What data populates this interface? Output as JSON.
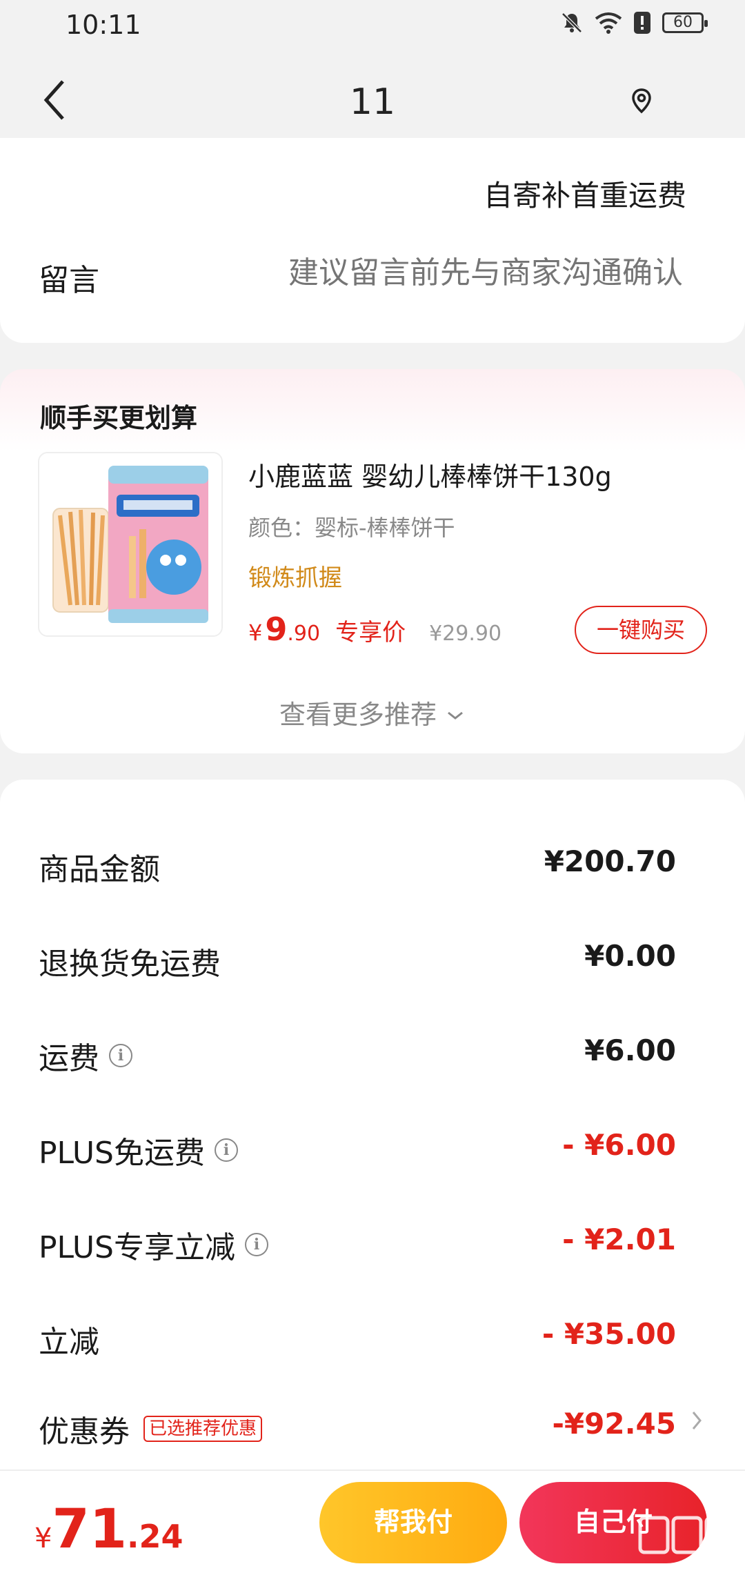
{
  "status_bar": {
    "time": "10:11",
    "battery": "60"
  },
  "header": {
    "title": "11",
    "back_icon": "chevron-left-icon",
    "location_icon": "location-pin-icon"
  },
  "shipping": {
    "note": "自寄补首重运费"
  },
  "message": {
    "label": "留言",
    "placeholder": "建议留言前先与商家沟通确认"
  },
  "recommend": {
    "title": "顺手买更划算",
    "product": {
      "name": "小鹿蓝蓝 婴幼儿棒棒饼干130g",
      "variant": "颜色：婴标-棒棒饼干",
      "tag": "锻炼抓握",
      "price_currency": "¥",
      "price_int": "9",
      "price_dec": ".90",
      "price_label": "专享价",
      "original_price": "¥29.90",
      "buy_label": "一键购买"
    },
    "more_label": "查看更多推荐"
  },
  "fees": {
    "goods": {
      "label": "商品金额",
      "value": "¥200.70"
    },
    "return_free": {
      "label": "退换货免运费",
      "value": "¥0.00"
    },
    "shipping": {
      "label": "运费",
      "value": "¥6.00"
    },
    "plus_free_ship": {
      "label": "PLUS免运费",
      "value": "- ¥6.00"
    },
    "plus_discount": {
      "label": "PLUS专享立减",
      "value": "- ¥2.01"
    },
    "discount": {
      "label": "立减",
      "value": "- ¥35.00"
    },
    "coupon": {
      "label": "优惠券",
      "badge": "已选推荐优惠",
      "value": "-¥92.45"
    }
  },
  "bottom": {
    "total_currency": "¥",
    "total_int": "71",
    "total_dec": ".24",
    "help_pay": "帮我付",
    "self_pay": "自己付"
  },
  "colors": {
    "accent_red": "#e2231a",
    "gold": "#d18a1a",
    "help_pay_yellow": "#ffc62a"
  }
}
